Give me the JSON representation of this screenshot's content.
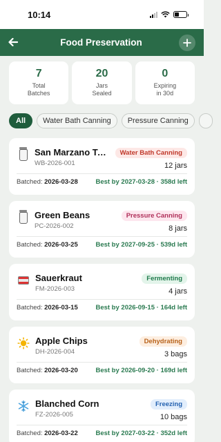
{
  "status_bar": {
    "time": "10:14"
  },
  "header": {
    "title": "Food Preservation"
  },
  "stats": [
    {
      "value": "7",
      "label_line1": "Total",
      "label_line2": "Batches"
    },
    {
      "value": "20",
      "label_line1": "Jars",
      "label_line2": "Sealed"
    },
    {
      "value": "0",
      "label_line1": "Expiring",
      "label_line2": "in 30d"
    }
  ],
  "filters": [
    "All",
    "Water Bath Canning",
    "Pressure Canning"
  ],
  "batches": [
    {
      "icon": "jar-icon",
      "name": "San Marzano To...",
      "code": "WB-2026-001",
      "method": "Water Bath Canning",
      "method_color": "#c0392b",
      "method_bg": "#fde8e6",
      "qty": "12 jars",
      "batched_label": "Batched:",
      "batched_date": "2026-03-28",
      "best_by": "Best by 2027-03-28 · 358d left"
    },
    {
      "icon": "jar-icon",
      "name": "Green Beans",
      "code": "PC-2026-002",
      "method": "Pressure Canning",
      "method_color": "#b0305a",
      "method_bg": "#fde6ee",
      "qty": "8 jars",
      "batched_label": "Batched:",
      "batched_date": "2026-03-25",
      "best_by": "Best by 2027-09-25 · 539d left"
    },
    {
      "icon": "tin-icon",
      "name": "Sauerkraut",
      "code": "FM-2026-003",
      "method": "Fermenting",
      "method_color": "#1f7a4c",
      "method_bg": "#e3f4ea",
      "qty": "4 jars",
      "batched_label": "Batched:",
      "batched_date": "2026-03-15",
      "best_by": "Best by 2026-09-15 · 164d left"
    },
    {
      "icon": "sun-icon",
      "name": "Apple Chips",
      "code": "DH-2026-004",
      "method": "Dehydrating",
      "method_color": "#b8621a",
      "method_bg": "#fdeee0",
      "qty": "3 bags",
      "batched_label": "Batched:",
      "batched_date": "2026-03-20",
      "best_by": "Best by 2026-09-20 · 169d left"
    },
    {
      "icon": "snowflake-icon",
      "name": "Blanched Corn",
      "code": "FZ-2026-005",
      "method": "Freezing",
      "method_color": "#2462b0",
      "method_bg": "#e2eefc",
      "qty": "10 bags",
      "batched_label": "Batched:",
      "batched_date": "2026-03-22",
      "best_by": "Best by 2027-03-22 · 352d left"
    }
  ]
}
